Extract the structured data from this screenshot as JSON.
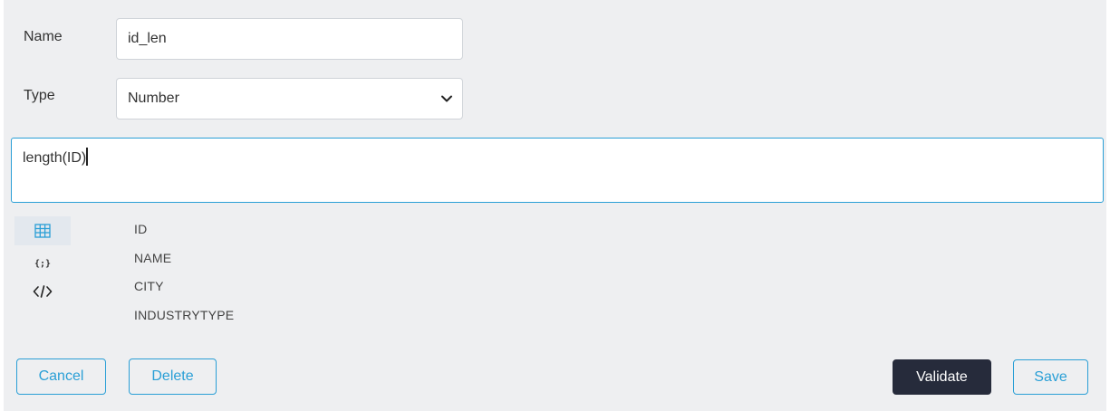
{
  "form": {
    "name_label": "Name",
    "name_value": "id_len",
    "type_label": "Type",
    "type_value": "Number"
  },
  "editor": {
    "expression": "length(ID)"
  },
  "palette": {
    "tabs": [
      {
        "icon": "table-grid-icon",
        "active": true
      },
      {
        "icon": "braces-icon",
        "active": false
      },
      {
        "icon": "code-tag-icon",
        "active": false
      }
    ],
    "fields": [
      "ID",
      "NAME",
      "CITY",
      "INDUSTRYTYPE"
    ]
  },
  "buttons": {
    "cancel": "Cancel",
    "delete": "Delete",
    "validate": "Validate",
    "save": "Save"
  },
  "colors": {
    "accent": "#2a9fd6",
    "dark_button": "#262b3b",
    "panel_bg": "#eeeff1"
  }
}
